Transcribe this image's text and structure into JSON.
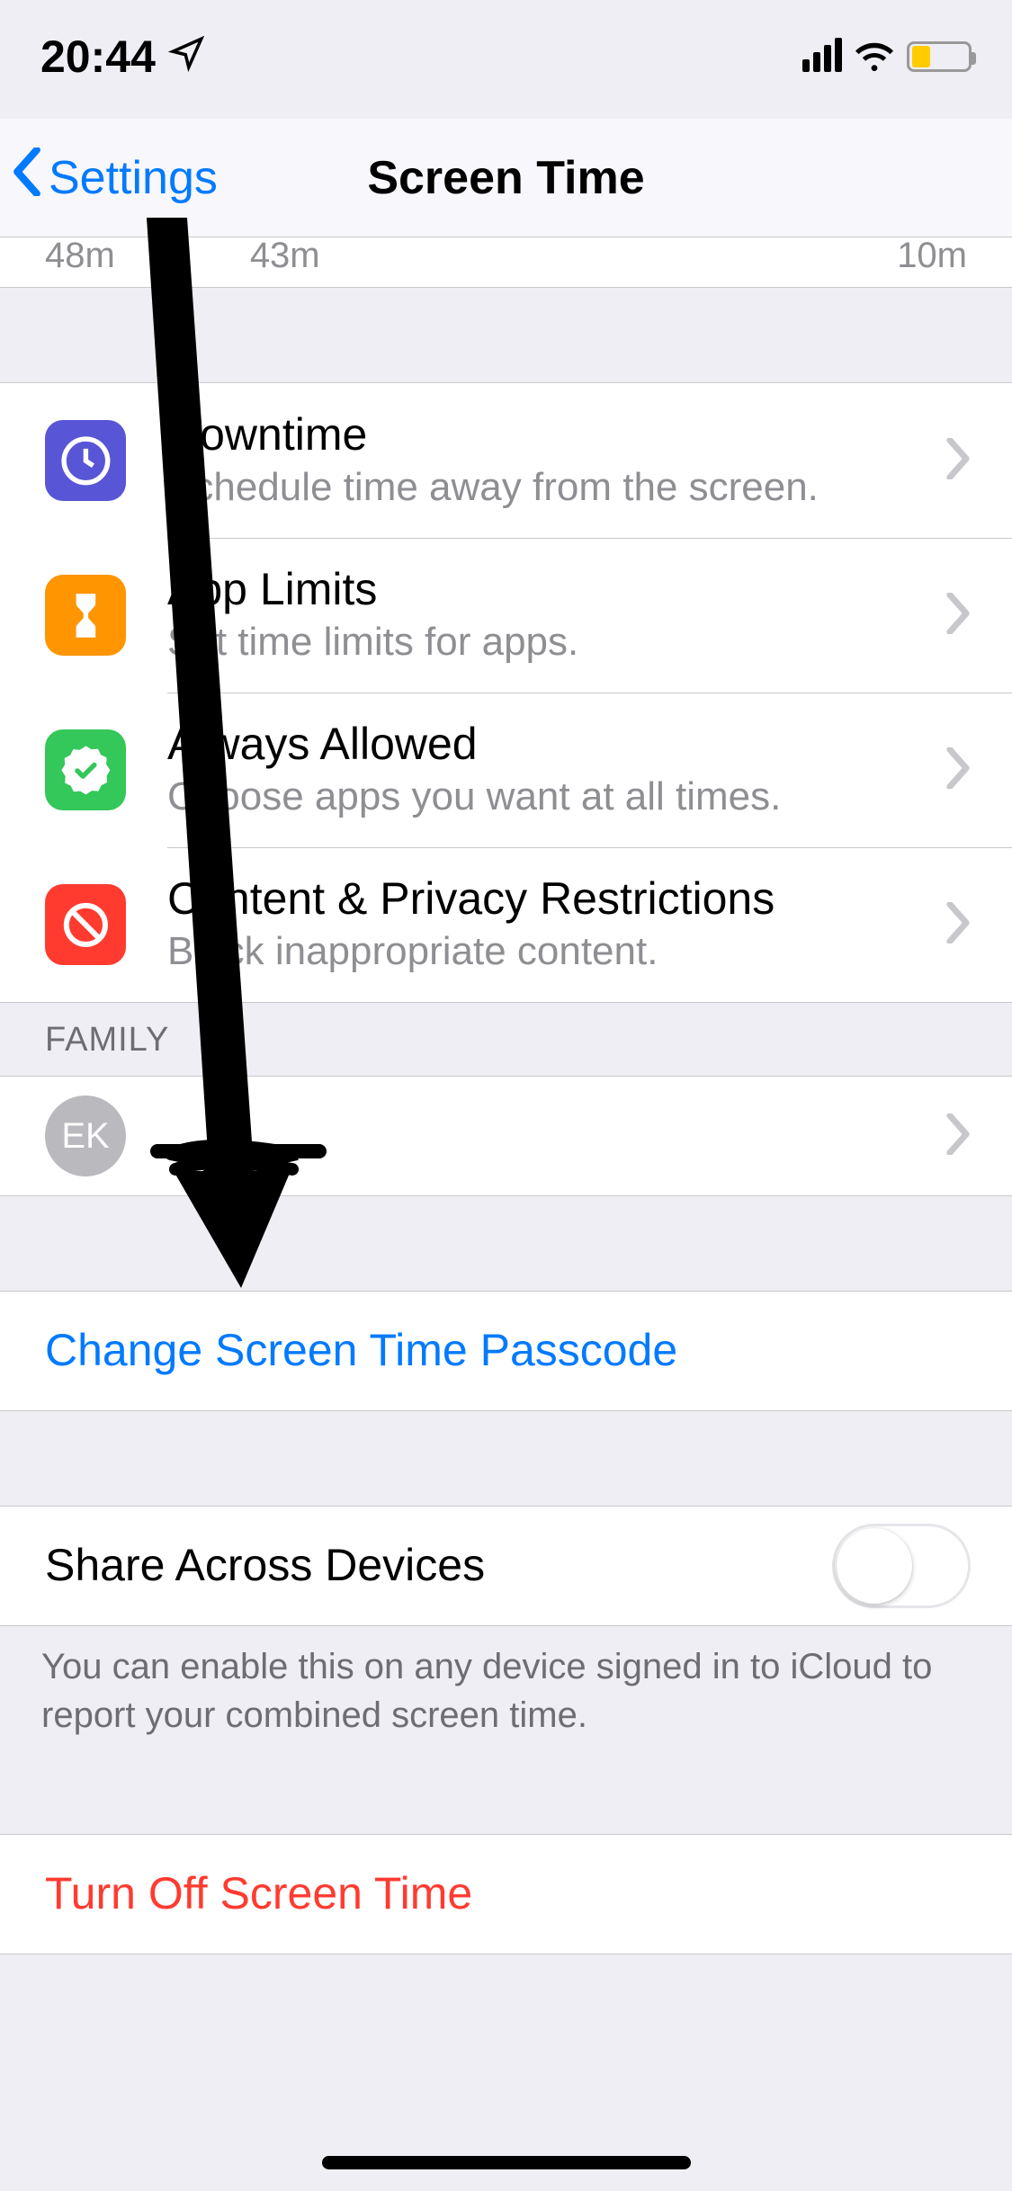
{
  "status": {
    "time": "20:44",
    "location_icon": true,
    "battery_low_power": true
  },
  "nav": {
    "back_label": "Settings",
    "title": "Screen Time"
  },
  "peek_values": [
    "48m",
    "43m",
    "10m"
  ],
  "settings_rows": [
    {
      "icon_color": "#5856d6",
      "icon": "downtime-icon",
      "title": "Downtime",
      "subtitle": "Schedule time away from the screen."
    },
    {
      "icon_color": "#ff9500",
      "icon": "app-limits-icon",
      "title": "App Limits",
      "subtitle": "Set time limits for apps."
    },
    {
      "icon_color": "#34c759",
      "icon": "always-allowed-icon",
      "title": "Always Allowed",
      "subtitle": "Choose apps you want at all times."
    },
    {
      "icon_color": "#ff3b30",
      "icon": "restrictions-icon",
      "title": "Content & Privacy Restrictions",
      "subtitle": "Block inappropriate content."
    }
  ],
  "family": {
    "header": "FAMILY",
    "members": [
      {
        "initials": "EK",
        "name_scribbled": true
      }
    ]
  },
  "passcode_row": {
    "title": "Change Screen Time Passcode"
  },
  "share_row": {
    "title": "Share Across Devices",
    "enabled": false,
    "footer": "You can enable this on any device signed in to iCloud to report your combined screen time."
  },
  "turn_off_row": {
    "title": "Turn Off Screen Time"
  },
  "chart_data": {
    "type": "bar",
    "note": "Row of small time value labels visible just below the nav bar (chart itself scrolled out of view)",
    "visible_values_labels": [
      "48m",
      "43m",
      "10m"
    ]
  }
}
